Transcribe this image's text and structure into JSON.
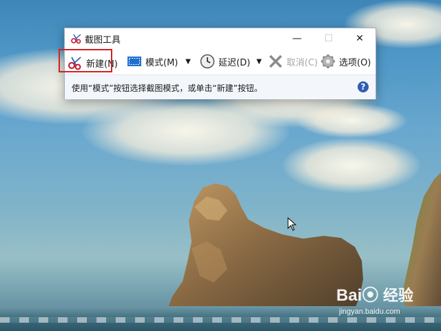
{
  "window": {
    "title": "截图工具",
    "minimize_glyph": "—",
    "maximize_glyph": "☐",
    "close_glyph": "✕"
  },
  "toolbar": {
    "new_label": "新建(N)",
    "mode_label": "模式(M)",
    "delay_label": "延迟(D)",
    "cancel_label": "取消(C)",
    "options_label": "选项(O)",
    "dropdown_glyph": "▼"
  },
  "status": {
    "text": "使用“模式”按钮选择截图模式，或单击“新建”按钮。",
    "help_glyph": "?"
  },
  "watermark": {
    "logo": "Bai⦿",
    "cn": "经验",
    "url": "jingyan.baidu.com"
  },
  "colors": {
    "highlight": "#d42020",
    "help_icon": "#2d5fb1",
    "disabled_text": "#a6a6a6"
  },
  "icons": {
    "app": "scissors-icon",
    "new": "scissors-icon",
    "mode": "rectangle-snip-icon",
    "delay": "clock-icon",
    "cancel": "x-icon",
    "options": "gear-icon",
    "help": "question-icon",
    "cursor": "mouse-pointer-icon"
  }
}
